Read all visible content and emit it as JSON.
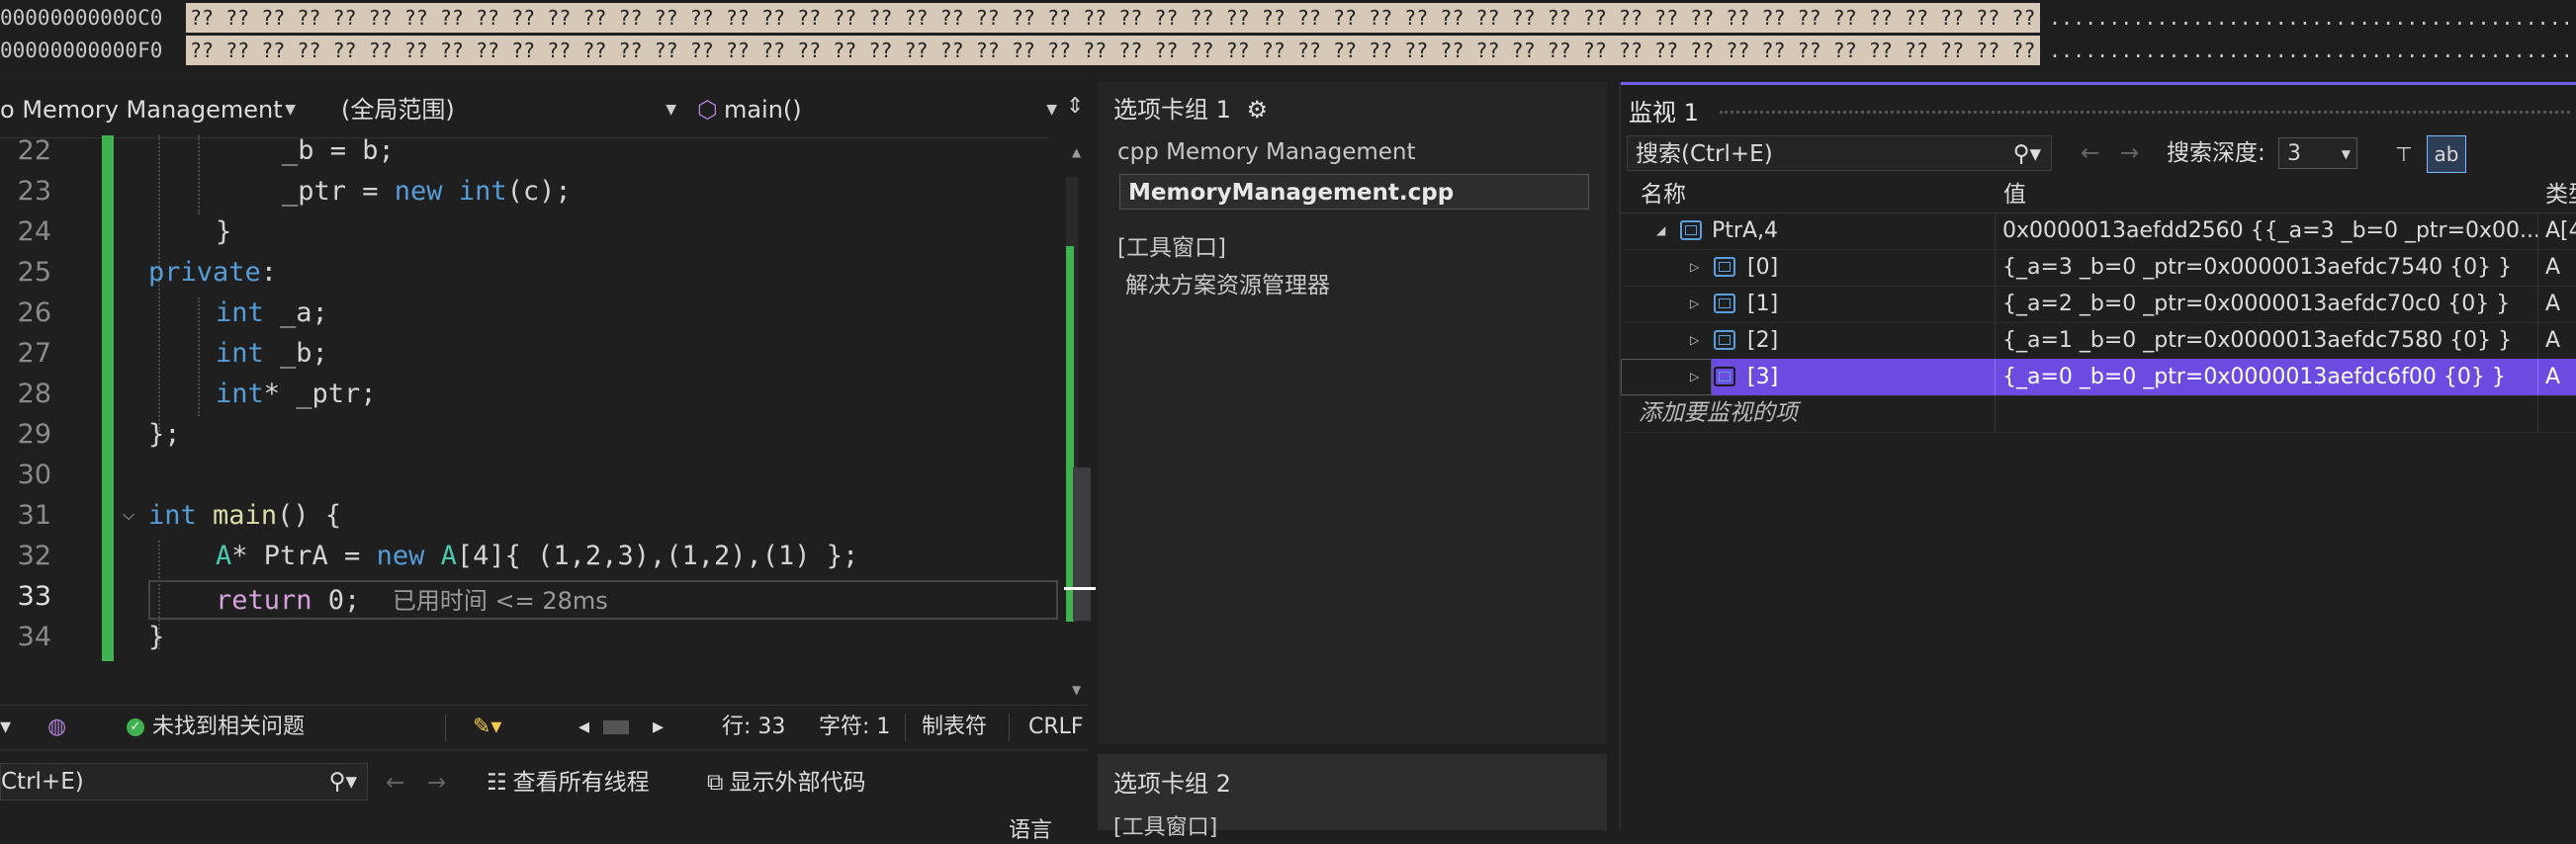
{
  "memory": {
    "rows": [
      {
        "address": "00000000000C0",
        "bytes": "?? ?? ?? ?? ?? ?? ?? ?? ?? ?? ?? ?? ?? ?? ?? ?? ?? ?? ?? ?? ?? ?? ?? ?? ?? ?? ?? ?? ?? ?? ?? ?? ?? ?? ?? ?? ?? ?? ?? ?? ?? ?? ?? ?? ?? ?? ?? ?? ?? ?? ?? ?? ?? ?? ?? ?? ?? ?? ?? ?? ?? ??",
        "ascii": "................................................................"
      },
      {
        "address": "00000000000F0",
        "bytes": "?? ?? ?? ?? ?? ?? ?? ?? ?? ?? ?? ?? ?? ?? ?? ?? ?? ?? ?? ?? ?? ?? ?? ?? ?? ?? ?? ?? ?? ?? ?? ?? ?? ?? ?? ?? ?? ?? ?? ?? ?? ?? ?? ?? ?? ?? ?? ?? ?? ?? ?? ?? ?? ?? ?? ?? ?? ?? ?? ?? ?? ??",
        "ascii": "................................................................"
      }
    ]
  },
  "editor": {
    "nav": {
      "project": "o Memory Management",
      "scope": "(全局范围)",
      "function": "main()"
    },
    "line_numbers": [
      "22",
      "23",
      "24",
      "25",
      "26",
      "27",
      "28",
      "29",
      "30",
      "31",
      "32",
      "33",
      "34"
    ],
    "lines": [
      {
        "t1": "_b = b;"
      },
      {
        "t1": "_ptr = ",
        "kw": "new",
        "ty": "int",
        "t2": "(c);"
      },
      {
        "t1": "}"
      },
      {
        "kw": "private",
        "t1": ":"
      },
      {
        "kw": "int",
        "t1": " _a;"
      },
      {
        "kw": "int",
        "t1": " _b;"
      },
      {
        "kw": "int",
        "t1": "* _ptr;"
      },
      {
        "t1": "};"
      },
      {
        "t1": ""
      },
      {
        "kw": "int",
        "fn": "main",
        "t1": "() {"
      },
      {
        "ty": "A",
        "t1": "* PtrA = ",
        "kw": "new",
        "ty2": "A",
        "t2": "[4]{ (1,2,3),(1,2),(1) };"
      },
      {
        "ret": "return",
        "t1": " 0;",
        "hint": "已用时间 <= 28ms"
      },
      {
        "t1": "}"
      }
    ]
  },
  "status": {
    "issues": "未找到相关问题",
    "line": "行: 33",
    "char": "字符: 1",
    "tabs": "制表符",
    "eol": "CRLF"
  },
  "bottombar": {
    "search": "Ctrl+E)",
    "view_threads": "查看所有线程",
    "show_external": "显示外部代码",
    "lang": "语言"
  },
  "tabgroup1": {
    "title": "选项卡组 1",
    "project": "cpp Memory Management",
    "file": "MemoryManagement.cpp",
    "section": "[工具窗口]",
    "entry": "解决方案资源管理器"
  },
  "tabgroup2": {
    "title": "选项卡组 2",
    "section": "[工具窗口]"
  },
  "watch": {
    "title": "监视 1",
    "search_placeholder": "搜索(Ctrl+E)",
    "depth_label": "搜索深度:",
    "depth_value": "3",
    "col_name": "名称",
    "col_value": "值",
    "col_type": "类型",
    "rows": [
      {
        "name": "PtrA,4",
        "value": "0x0000013aefdd2560 {{_a=3 _b=0 _ptr=0x00...",
        "type": "A[4",
        "level": 0,
        "expanded": true,
        "selected": false
      },
      {
        "name": "[0]",
        "value": "{_a=3 _b=0 _ptr=0x0000013aefdc7540 {0} }",
        "type": "A",
        "level": 1,
        "expanded": false,
        "selected": false
      },
      {
        "name": "[1]",
        "value": "{_a=2 _b=0 _ptr=0x0000013aefdc70c0 {0} }",
        "type": "A",
        "level": 1,
        "expanded": false,
        "selected": false
      },
      {
        "name": "[2]",
        "value": "{_a=1 _b=0 _ptr=0x0000013aefdc7580 {0} }",
        "type": "A",
        "level": 1,
        "expanded": false,
        "selected": false
      },
      {
        "name": "[3]",
        "value": "{_a=0 _b=0 _ptr=0x0000013aefdc6f00 {0} }",
        "type": "A",
        "level": 1,
        "expanded": false,
        "selected": true
      }
    ],
    "add_item": "添加要监视的项"
  }
}
